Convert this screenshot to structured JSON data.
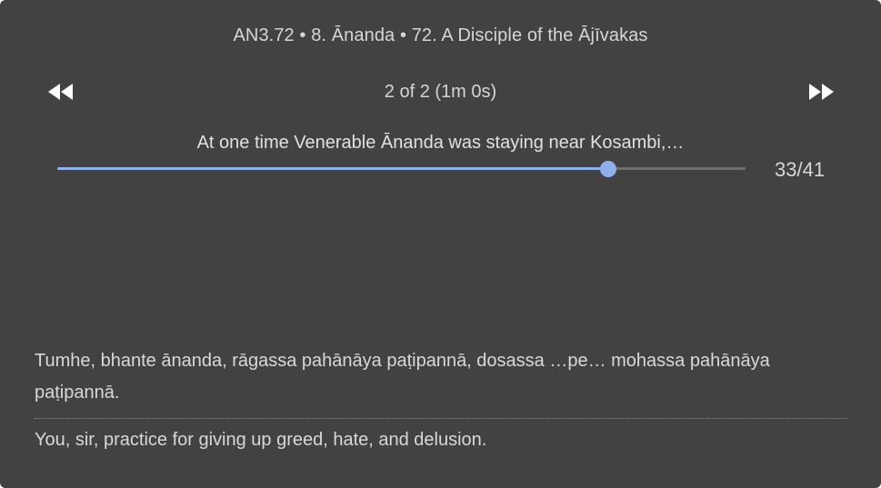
{
  "header": {
    "title": "AN3.72 • 8. Ānanda • 72. A Disciple of the Ājīvakas"
  },
  "navigation": {
    "previous_icon": "rewind-icon",
    "next_icon": "fast-forward-icon",
    "counter": "2 of 2 (1m 0s)"
  },
  "player": {
    "segment_text": "At one time Venerable Ānanda was staying near Kosambi,…",
    "position_label": "33/41",
    "current": 33,
    "total": 41,
    "progress_fraction": 0.8
  },
  "passage": {
    "pali": "Tumhe, bhante ānanda, rāgassa pahānāya paṭipannā, dosassa …pe… mohassa pahānāya paṭipannā.",
    "translation": "You, sir, practice for giving up greed, hate, and delusion."
  },
  "colors": {
    "background": "#424242",
    "accent": "#8fb0ee",
    "text": "#d8d8d8"
  }
}
